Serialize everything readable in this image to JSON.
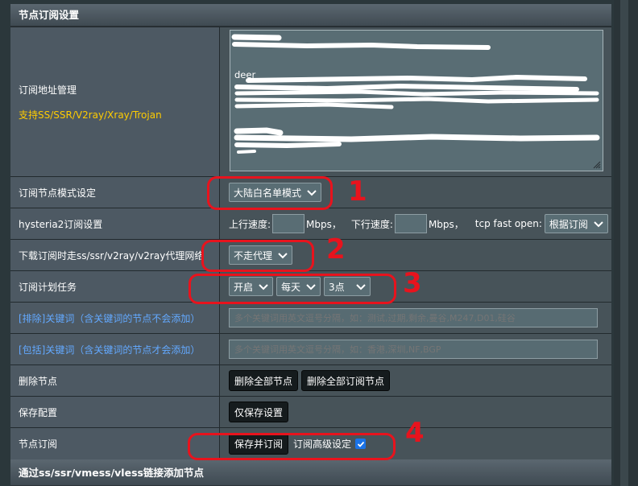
{
  "section": {
    "title": "节点订阅设置",
    "bottom_title": "通过ss/ssr/vmess/vless链接添加节点"
  },
  "subscription": {
    "label": "订阅地址管理",
    "note": "支持SS/SSR/V2ray/Xray/Trojan",
    "lines": [
      "",
      "",
      "",
      "deer",
      "",
      "",
      "",
      "",
      "",
      "",
      ""
    ]
  },
  "node_mode": {
    "label": "订阅节点模式设定",
    "value": "大陆白名单模式"
  },
  "hysteria2": {
    "label": "hysteria2订阅设置",
    "up_label": "上行速度:",
    "up_unit": "Mbps，",
    "down_label": "下行速度:",
    "down_unit": "Mbps，",
    "tfo_label": "tcp fast open:",
    "tfo_value": "根据订阅"
  },
  "proxy": {
    "label": "下载订阅时走ss/ssr/v2ray/v2ray代理网络",
    "value": "不走代理"
  },
  "schedule": {
    "label": "订阅计划任务",
    "enable": "开启",
    "freq": "每天",
    "time": "3点"
  },
  "exclude": {
    "label": "[排除]关键词（含关键词的节点不会添加）",
    "placeholder": "多个关键词用英文逗号分隔，如：测试,过期,剩余,曼谷,M247,D01,硅谷"
  },
  "include": {
    "label": "[包括]关键词（含关键词的节点才会添加）",
    "placeholder": "多个关键词用英文逗号分隔，如：香港,深圳,NF,BGP"
  },
  "delete": {
    "label": "删除节点",
    "btn_all": "删除全部节点",
    "btn_sub": "删除全部订阅节点"
  },
  "save": {
    "label": "保存配置",
    "btn": "仅保存设置"
  },
  "subscribe": {
    "label": "节点订阅",
    "btn": "保存并订阅",
    "adv_label": "订阅高级设定",
    "adv_checked": true
  },
  "annotations": [
    "1",
    "2",
    "3",
    "4"
  ],
  "colors": {
    "annotation": "#e8131d",
    "link": "#63a9ff",
    "note": "#ffcc00"
  }
}
